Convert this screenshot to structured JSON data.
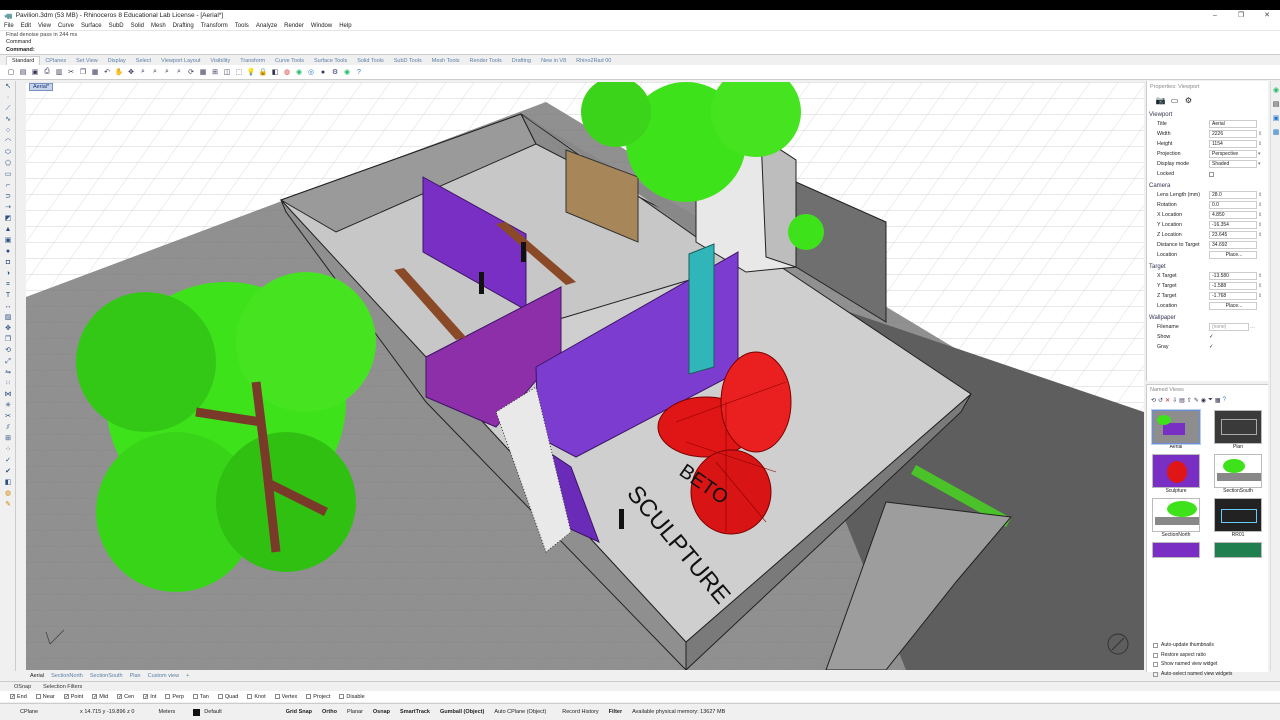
{
  "app": {
    "title": "Pavilion.3dm (53 MB) - Rhinoceros 8 Educational Lab License - [Aerial*]",
    "window_buttons": [
      "–",
      "❐",
      "✕"
    ]
  },
  "menu": [
    "File",
    "Edit",
    "View",
    "Curve",
    "Surface",
    "SubD",
    "Solid",
    "Mesh",
    "Drafting",
    "Transform",
    "Tools",
    "Analyze",
    "Render",
    "Window",
    "Help"
  ],
  "command": {
    "history": "Final denoise pass in 244 ms",
    "line1": "Command",
    "prompt": "Command:"
  },
  "toolbar_tabs": [
    "Standard",
    "CPlanes",
    "Set View",
    "Display",
    "Select",
    "Viewport Layout",
    "Visibility",
    "Transform",
    "Curve Tools",
    "Surface Tools",
    "Solid Tools",
    "SubD Tools",
    "Mesh Tools",
    "Render Tools",
    "Drafting",
    "New in V8",
    "Rhino2Rad 00"
  ],
  "viewport": {
    "label": "Aerial*",
    "scene_text": [
      "SCULPTURE",
      "BETO"
    ]
  },
  "properties": {
    "title": "Properties: Viewport",
    "viewport_section": "Viewport",
    "rows_viewport": [
      {
        "k": "Title",
        "v": "Aerial"
      },
      {
        "k": "Width",
        "v": "2226"
      },
      {
        "k": "Height",
        "v": "1154"
      },
      {
        "k": "Projection",
        "v": "Perspective"
      },
      {
        "k": "Display mode",
        "v": "Shaded"
      },
      {
        "k": "Locked",
        "v": ""
      }
    ],
    "camera_section": "Camera",
    "rows_camera": [
      {
        "k": "Lens Length (mm)",
        "v": "28.0"
      },
      {
        "k": "Rotation",
        "v": "0.0"
      },
      {
        "k": "X Location",
        "v": "4.850"
      },
      {
        "k": "Y Location",
        "v": "-16.354"
      },
      {
        "k": "Z Location",
        "v": "23.645"
      },
      {
        "k": "Distance to Target",
        "v": "34.692"
      },
      {
        "k": "Location",
        "v": "Place..."
      }
    ],
    "target_section": "Target",
    "rows_target": [
      {
        "k": "X Target",
        "v": "-13.580"
      },
      {
        "k": "Y Target",
        "v": "-1.588"
      },
      {
        "k": "Z Target",
        "v": "-1.768"
      },
      {
        "k": "Location",
        "v": "Place..."
      }
    ],
    "wallpaper_section": "Wallpaper",
    "rows_wallpaper": [
      {
        "k": "Filename",
        "v": "(none)"
      },
      {
        "k": "Show",
        "v": "✓"
      },
      {
        "k": "Gray",
        "v": "✓"
      }
    ]
  },
  "named_views": {
    "title": "Named Views",
    "views": [
      "Aerial",
      "Plan",
      "Sculpture",
      "SectionSouth",
      "SectionNorth",
      "RR01",
      "",
      ""
    ],
    "options": [
      "Auto-update thumbnails",
      "Restore aspect ratio",
      "Show named view widget",
      "Auto-select named view widgets"
    ]
  },
  "view_tabs": [
    "Aerial",
    "SectionNorth",
    "SectionSouth",
    "Plan",
    "Custom view",
    "+"
  ],
  "osnap_tabs": [
    "OSnap",
    "Selection Filters"
  ],
  "osnaps": [
    {
      "label": "End",
      "on": true
    },
    {
      "label": "Near",
      "on": false
    },
    {
      "label": "Point",
      "on": true
    },
    {
      "label": "Mid",
      "on": true
    },
    {
      "label": "Cen",
      "on": true
    },
    {
      "label": "Int",
      "on": true
    },
    {
      "label": "Perp",
      "on": false
    },
    {
      "label": "Tan",
      "on": false
    },
    {
      "label": "Quad",
      "on": false
    },
    {
      "label": "Knot",
      "on": false
    },
    {
      "label": "Vertex",
      "on": false
    },
    {
      "label": "Project",
      "on": false
    },
    {
      "label": "Disable",
      "on": false
    }
  ],
  "status": {
    "cplane": "CPlane",
    "coords": "x 14.715  y -19.896  z 0",
    "units": "Meters",
    "layer": "Default",
    "grid_snap": "Grid Snap",
    "ortho": "Ortho",
    "planar": "Planar",
    "osnap": "Osnap",
    "smarttrack": "SmartTrack",
    "gumball": "Gumball (Object)",
    "autocplane": "Auto CPlane (Object)",
    "record": "Record History",
    "filter": "Filter",
    "memory": "Available physical memory: 13627 MB"
  },
  "colors": {
    "wall_purple": "#7a2fc4",
    "sculpture_red": "#e01515",
    "tree_green": "#3ee21a"
  }
}
